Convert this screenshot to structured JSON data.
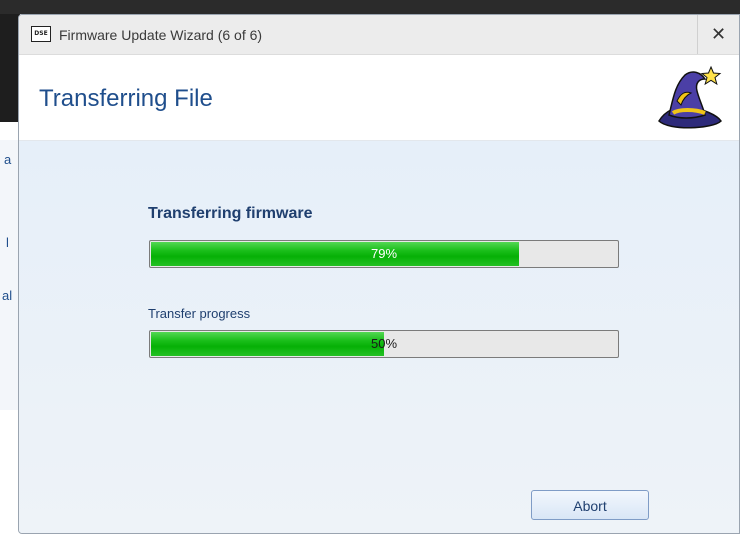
{
  "window": {
    "title": "Firmware Update Wizard (6 of 6)",
    "app_icon_text": "DSE",
    "close_glyph": "✕"
  },
  "header": {
    "title": "Transferring File",
    "icon": "wizard-hat-icon"
  },
  "main": {
    "firmware_label": "Transferring firmware",
    "firmware_progress": {
      "value": 79,
      "label": "79%"
    },
    "transfer_label": "Transfer progress",
    "transfer_progress": {
      "value": 50,
      "label": "50%"
    }
  },
  "footer": {
    "abort_label": "Abort"
  },
  "background": {
    "fragments": [
      "a",
      "l",
      "al"
    ]
  },
  "colors": {
    "accent": "#1f4e8c",
    "progress_fill": "#06b006",
    "content_bg": "#e6eff9"
  }
}
